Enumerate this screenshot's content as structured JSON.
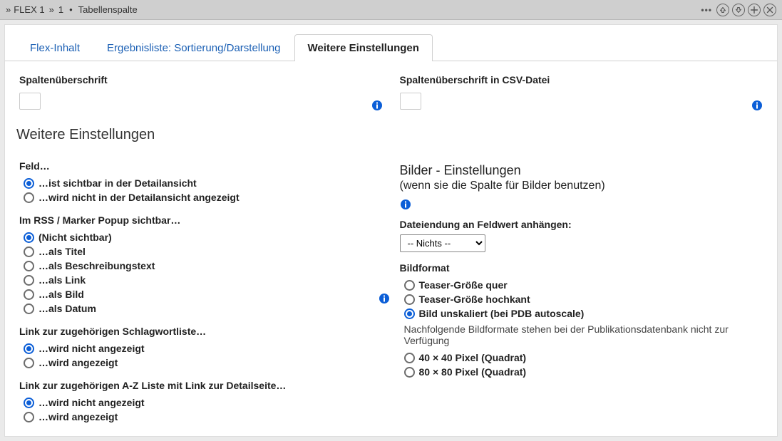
{
  "header": {
    "breadcrumbs": [
      "FLEX 1",
      "1"
    ],
    "type_label": "Tabellenspalte"
  },
  "tabs": [
    {
      "label": "Flex-Inhalt",
      "active": false
    },
    {
      "label": "Ergebnisliste: Sortierung/Darstellung",
      "active": false
    },
    {
      "label": "Weitere Einstellungen",
      "active": true
    }
  ],
  "left_fields": {
    "caption_label": "Spaltenüberschrift",
    "caption_value": ""
  },
  "right_fields": {
    "csv_caption_label": "Spaltenüberschrift in CSV-Datei",
    "csv_caption_value": ""
  },
  "section_title": "Weitere Einstellungen",
  "groups": {
    "visibility": {
      "heading": "Feld…",
      "options": [
        {
          "label": "…ist sichtbar in der Detailansicht",
          "selected": true
        },
        {
          "label": "…wird nicht in der Detailansicht angezeigt",
          "selected": false
        }
      ]
    },
    "rss": {
      "heading": "Im RSS / Marker Popup sichtbar…",
      "options": [
        {
          "label": "(Nicht sichtbar)",
          "selected": true
        },
        {
          "label": "…als Titel",
          "selected": false
        },
        {
          "label": "…als Beschreibungstext",
          "selected": false
        },
        {
          "label": "…als Link",
          "selected": false
        },
        {
          "label": "…als Bild",
          "selected": false
        },
        {
          "label": "…als Datum",
          "selected": false
        }
      ]
    },
    "tag_link": {
      "heading": "Link zur zugehörigen Schlagwortliste…",
      "options": [
        {
          "label": "…wird nicht angezeigt",
          "selected": true
        },
        {
          "label": "…wird angezeigt",
          "selected": false
        }
      ]
    },
    "az_link": {
      "heading": "Link zur zugehörigen A-Z Liste mit Link zur Detailseite…",
      "options": [
        {
          "label": "…wird nicht angezeigt",
          "selected": true
        },
        {
          "label": "…wird angezeigt",
          "selected": false
        }
      ]
    }
  },
  "images": {
    "title": "Bilder - Einstellungen",
    "subtitle": "(wenn sie die Spalte für Bilder benutzen)",
    "ext_label": "Dateiendung an Feldwert anhängen:",
    "ext_selected": "-- Nichts --",
    "ext_options": [
      "-- Nichts --"
    ],
    "format_heading": "Bildformat",
    "note": "Nachfolgende Bildformate stehen bei der Publikationsdatenbank nicht zur Verfügung",
    "options": [
      {
        "label": "Teaser-Größe quer",
        "selected": false
      },
      {
        "label": "Teaser-Größe hochkant",
        "selected": false
      },
      {
        "label": "Bild unskaliert (bei PDB autoscale)",
        "selected": true
      },
      {
        "label": "40 × 40 Pixel (Quadrat)",
        "selected": false,
        "after_note": true
      },
      {
        "label": "80 × 80 Pixel (Quadrat)",
        "selected": false,
        "after_note": true
      }
    ]
  }
}
